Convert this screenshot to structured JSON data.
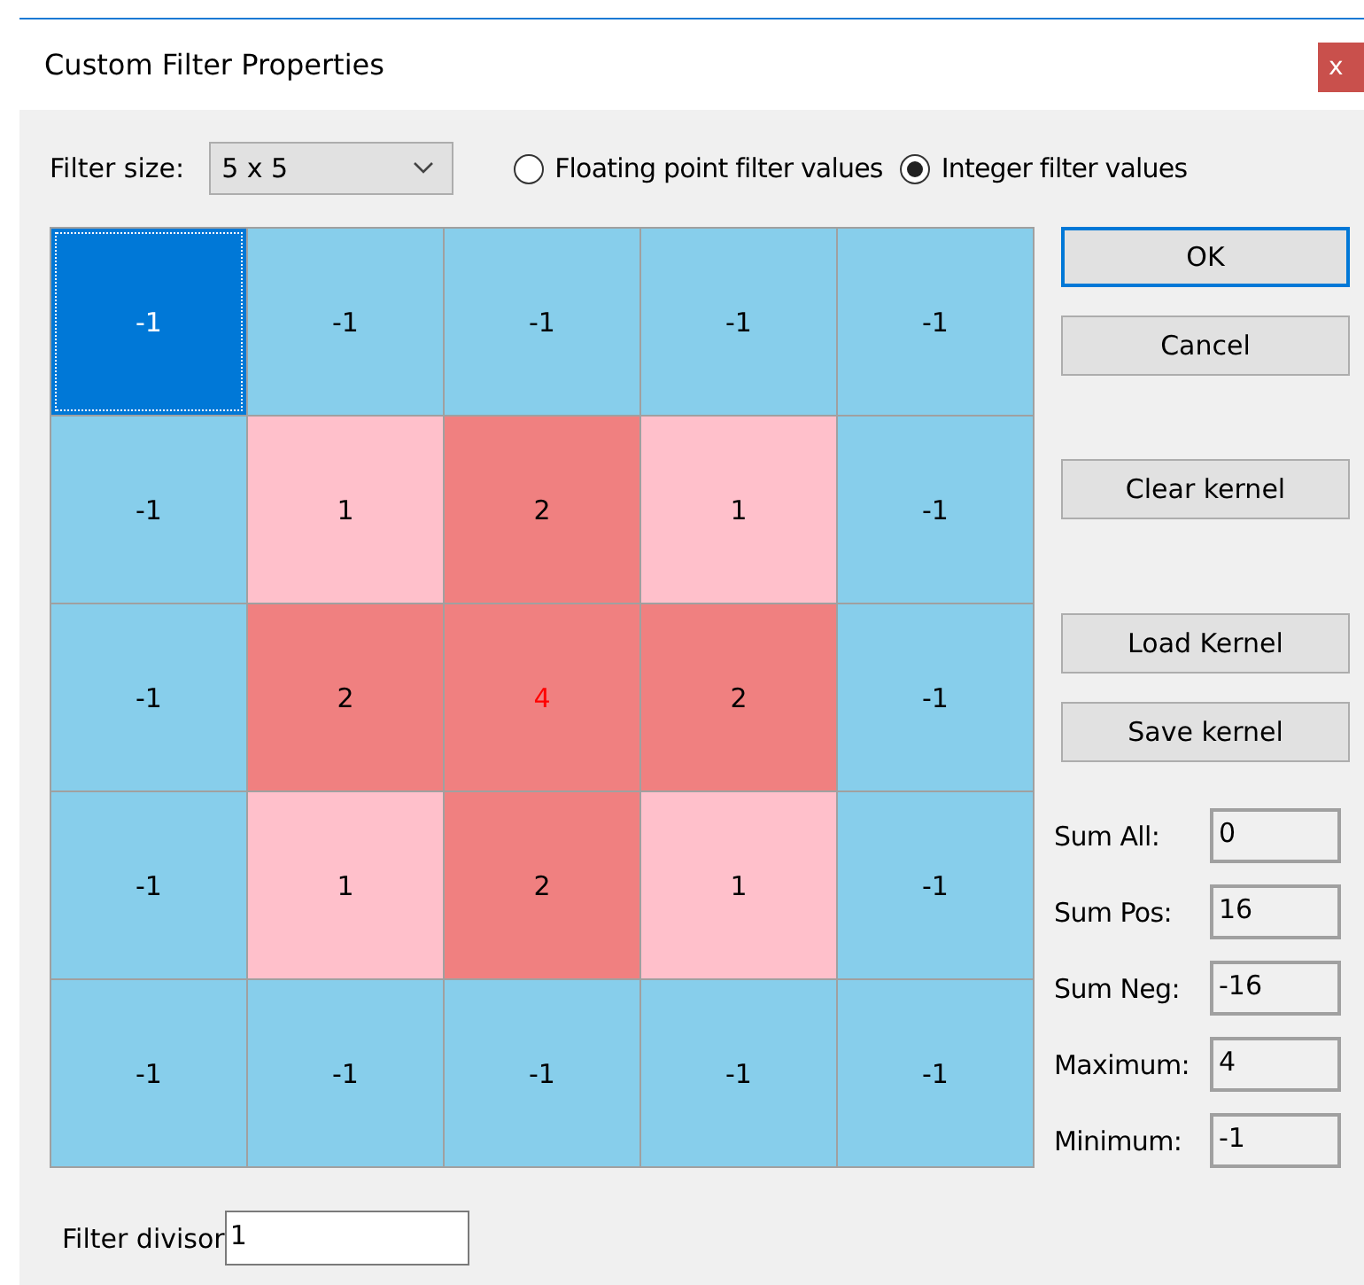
{
  "window": {
    "title": "Custom Filter Properties",
    "close": "x"
  },
  "filter_size": {
    "label": "Filter size:",
    "value": "5 x 5"
  },
  "value_type": [
    {
      "label": "Floating point filter values",
      "selected": false
    },
    {
      "label": "Integer filter values",
      "selected": true
    }
  ],
  "kernel": [
    [
      {
        "value": "-1",
        "color": "#0078d7",
        "selected": true,
        "emphasized": false
      },
      {
        "value": "-1",
        "color": "#87ceeb",
        "selected": false,
        "emphasized": false
      },
      {
        "value": "-1",
        "color": "#87ceeb",
        "selected": false,
        "emphasized": false
      },
      {
        "value": "-1",
        "color": "#87ceeb",
        "selected": false,
        "emphasized": false
      },
      {
        "value": "-1",
        "color": "#87ceeb",
        "selected": false,
        "emphasized": false
      }
    ],
    [
      {
        "value": "-1",
        "color": "#87ceeb",
        "selected": false,
        "emphasized": false
      },
      {
        "value": "1",
        "color": "#ffc0cb",
        "selected": false,
        "emphasized": false
      },
      {
        "value": "2",
        "color": "#f08080",
        "selected": false,
        "emphasized": false
      },
      {
        "value": "1",
        "color": "#ffc0cb",
        "selected": false,
        "emphasized": false
      },
      {
        "value": "-1",
        "color": "#87ceeb",
        "selected": false,
        "emphasized": false
      }
    ],
    [
      {
        "value": "-1",
        "color": "#87ceeb",
        "selected": false,
        "emphasized": false
      },
      {
        "value": "2",
        "color": "#f08080",
        "selected": false,
        "emphasized": false
      },
      {
        "value": "4",
        "color": "#f08080",
        "selected": false,
        "emphasized": true
      },
      {
        "value": "2",
        "color": "#f08080",
        "selected": false,
        "emphasized": false
      },
      {
        "value": "-1",
        "color": "#87ceeb",
        "selected": false,
        "emphasized": false
      }
    ],
    [
      {
        "value": "-1",
        "color": "#87ceeb",
        "selected": false,
        "emphasized": false
      },
      {
        "value": "1",
        "color": "#ffc0cb",
        "selected": false,
        "emphasized": false
      },
      {
        "value": "2",
        "color": "#f08080",
        "selected": false,
        "emphasized": false
      },
      {
        "value": "1",
        "color": "#ffc0cb",
        "selected": false,
        "emphasized": false
      },
      {
        "value": "-1",
        "color": "#87ceeb",
        "selected": false,
        "emphasized": false
      }
    ],
    [
      {
        "value": "-1",
        "color": "#87ceeb",
        "selected": false,
        "emphasized": false
      },
      {
        "value": "-1",
        "color": "#87ceeb",
        "selected": false,
        "emphasized": false
      },
      {
        "value": "-1",
        "color": "#87ceeb",
        "selected": false,
        "emphasized": false
      },
      {
        "value": "-1",
        "color": "#87ceeb",
        "selected": false,
        "emphasized": false
      },
      {
        "value": "-1",
        "color": "#87ceeb",
        "selected": false,
        "emphasized": false
      }
    ]
  ],
  "buttons": [
    {
      "label": "OK",
      "default": true,
      "kind": "dialog"
    },
    {
      "label": "Cancel",
      "default": false,
      "kind": "dialog"
    },
    {
      "label": "Clear kernel",
      "default": false,
      "kind": "clear"
    },
    {
      "label": "Load Kernel",
      "default": false,
      "kind": "file"
    },
    {
      "label": "Save kernel",
      "default": false,
      "kind": "file"
    }
  ],
  "stats": [
    {
      "label": "Sum All:",
      "value": "0"
    },
    {
      "label": "Sum Pos:",
      "value": "16"
    },
    {
      "label": "Sum Neg:",
      "value": "-16"
    },
    {
      "label": "Maximum:",
      "value": "4"
    },
    {
      "label": "Minimum:",
      "value": "-1"
    }
  ],
  "filter_divisor": {
    "label": "Filter divisor",
    "value": "1"
  }
}
